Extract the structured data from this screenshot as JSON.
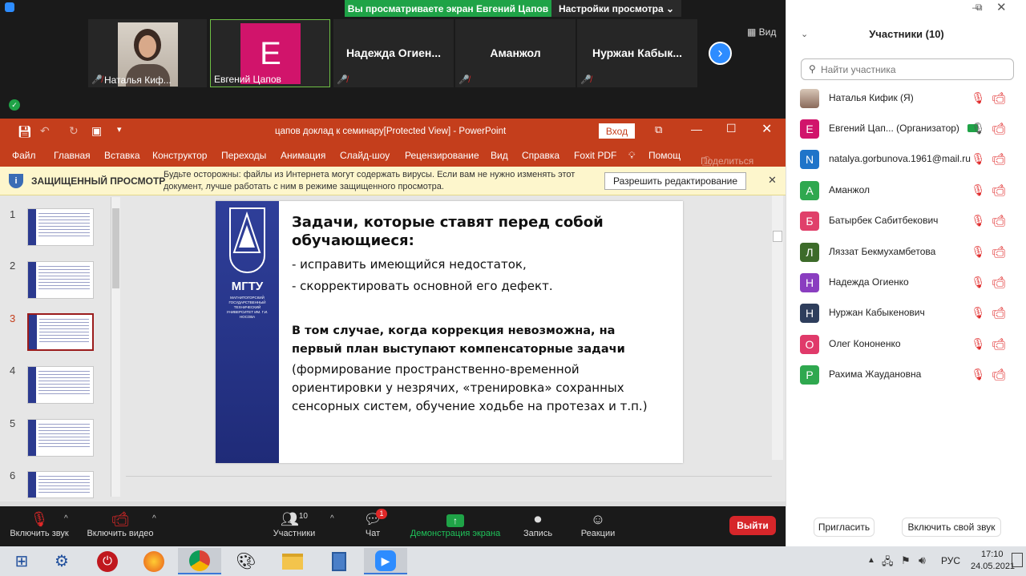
{
  "zoom": {
    "share_banner": "Вы просматриваете экран Евгений Цапов",
    "view_settings": "Настройки просмотра ⌄",
    "view_label": "Вид",
    "tiles": [
      {
        "name": "Наталья Киф..."
      },
      {
        "name": "Евгений Цапов",
        "initial": "E"
      },
      {
        "name": "Надежда Огиен..."
      },
      {
        "name": "Аманжол"
      },
      {
        "name": "Нуржан Кабык..."
      }
    ]
  },
  "ppt": {
    "title": "цапов доклад к семинару[Protected View]  -  PowerPoint",
    "login_button": "Вход",
    "menu": [
      "Файл",
      "Главная",
      "Вставка",
      "Конструктор",
      "Переходы",
      "Анимация",
      "Слайд-шоу",
      "Рецензирование",
      "Вид",
      "Справка",
      "Foxit PDF",
      "Помощ",
      "Поделиться"
    ],
    "protected_title": "ЗАЩИЩЕННЫЙ ПРОСМОТР",
    "protected_msg_1": "Будьте осторожны: файлы из Интернета могут содержать вирусы. Если вам не нужно изменять этот",
    "protected_msg_2": "документ, лучше работать с ним в режиме защищенного просмотра.",
    "enable_edit": "Разрешить редактирование",
    "thumb_numbers": [
      "1",
      "2",
      "3",
      "4",
      "5",
      "6"
    ],
    "slide": {
      "logo_text": "МГТУ",
      "logo_sub": "МАГНИТОГОРСКИЙ ГОСУДАРСТВЕННЫЙ ТЕХНИЧЕСКИЙ УНИВЕРСИТЕТ ИМ. Г.И. НОСОВА",
      "heading_1": "Задачи, которые ставят перед собой",
      "heading_2": "обучающиеся:",
      "bullet_1": "- исправить имеющийся недостаток,",
      "bullet_2": "- скорректировать основной его дефект.",
      "bold_1": "В том случае, когда коррекция невозможна, на",
      "bold_2": "первый план выступают компенсаторные задачи",
      "para_1": "(формирование пространственно-временной",
      "para_2": "ориентировки у незрячих, «тренировка» сохранных",
      "para_3": "сенсорных систем, обучение ходьбе на протезах и т.п.)"
    }
  },
  "toolbar": {
    "mute": "Включить звук",
    "video": "Включить видео",
    "participants": "Участники",
    "participants_count": "10",
    "chat": "Чат",
    "chat_badge": "1",
    "share": "Демонстрация экрана",
    "record": "Запись",
    "reactions": "Реакции",
    "leave": "Выйти"
  },
  "panel": {
    "title": "Участники (10)",
    "search_placeholder": "Найти участника",
    "participants": [
      {
        "name": "Наталья Кифик (Я)",
        "initial": "",
        "color": "#8a6a5a"
      },
      {
        "name": "Евгений Цап...   (Организатор)",
        "initial": "E",
        "color": "#d1146b"
      },
      {
        "name": "natalya.gorbunova.1961@mail.ru",
        "initial": "N",
        "color": "#1f74c9"
      },
      {
        "name": "Аманжол",
        "initial": "А",
        "color": "#2fa84f"
      },
      {
        "name": "Батырбек Сабитбекович",
        "initial": "Б",
        "color": "#e0406a"
      },
      {
        "name": "Ляззат Бекмухамбетова",
        "initial": "Л",
        "color": "#3d6b2a"
      },
      {
        "name": "Надежда Огиенко",
        "initial": "Н",
        "color": "#8a3ec0"
      },
      {
        "name": "Нуржан Кабыкенович",
        "initial": "Н",
        "color": "#2e3e5c"
      },
      {
        "name": "Олег Кононенко",
        "initial": "О",
        "color": "#e03a6a"
      },
      {
        "name": "Рахима Жаудановна",
        "initial": "Р",
        "color": "#2fa84f"
      }
    ],
    "invite": "Пригласить",
    "unmute_me": "Включить свой звук"
  },
  "taskbar": {
    "lang": "РУС",
    "time": "17:10",
    "date": "24.05.2021"
  }
}
